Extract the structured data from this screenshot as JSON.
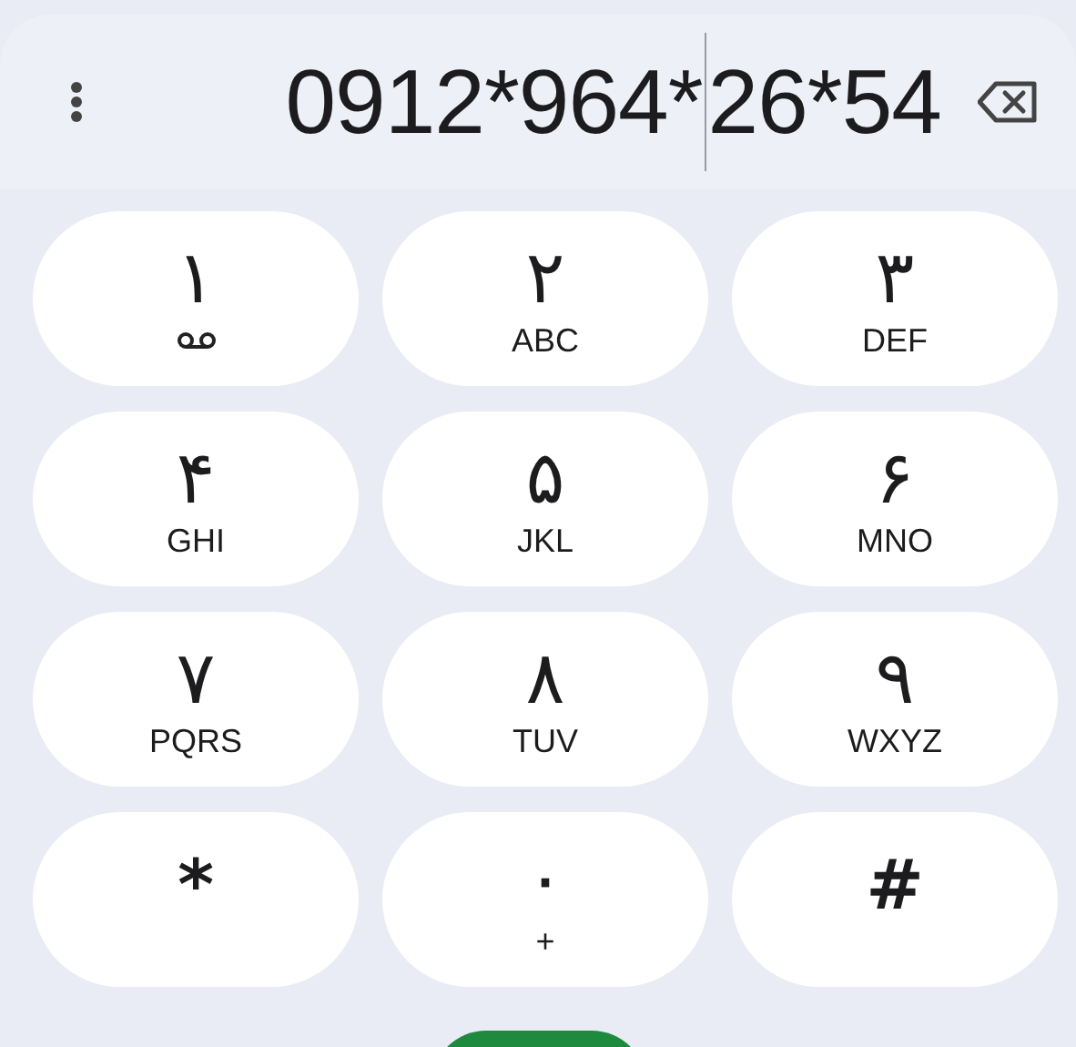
{
  "dial_field": {
    "before_cursor": "0912*964*",
    "after_cursor": "26*54"
  },
  "keypad_rows": [
    {
      "left": {
        "kind": "voicemail",
        "digit": "١"
      },
      "middle": {
        "kind": "letters",
        "digit": "٢",
        "letters": "ABC"
      },
      "right": {
        "kind": "letters",
        "digit": "٣",
        "letters": "DEF"
      }
    },
    {
      "left": {
        "kind": "letters",
        "digit": "۴",
        "letters": "GHI"
      },
      "middle": {
        "kind": "letters",
        "digit": "۵",
        "letters": "JKL"
      },
      "right": {
        "kind": "letters",
        "digit": "۶",
        "letters": "MNO"
      }
    },
    {
      "left": {
        "kind": "letters",
        "digit": "٧",
        "letters": "PQRS"
      },
      "middle": {
        "kind": "letters",
        "digit": "٨",
        "letters": "TUV"
      },
      "right": {
        "kind": "letters",
        "digit": "٩",
        "letters": "WXYZ"
      }
    },
    {
      "left": {
        "kind": "symbol",
        "digit": "*"
      },
      "middle": {
        "kind": "letters",
        "digit": "۰",
        "letters": "+"
      },
      "right": {
        "kind": "symbol",
        "digit": "#"
      }
    }
  ]
}
